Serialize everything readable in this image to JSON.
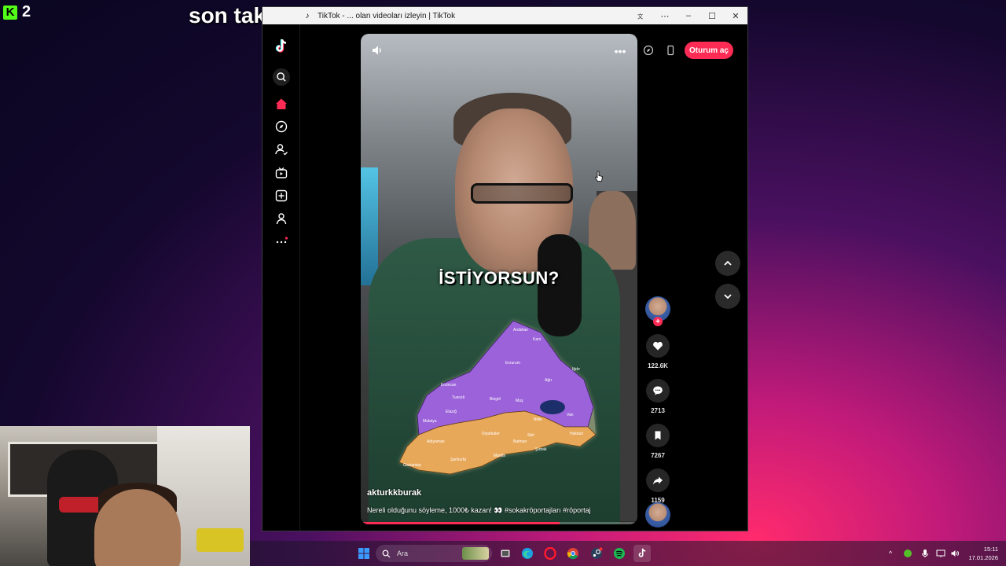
{
  "stream": {
    "viewer_count": "2",
    "overlay_caption": "son tak..."
  },
  "window": {
    "title": "TikTok - ... olan videoları izleyin | TikTok",
    "controls": [
      "translate",
      "more",
      "minimize",
      "maximize",
      "close"
    ]
  },
  "tiktok": {
    "login_label": "Oturum aç",
    "sidebar": [
      "logo",
      "search",
      "home",
      "explore",
      "following",
      "live",
      "upload",
      "profile",
      "more"
    ],
    "video": {
      "overlay_text": "İSTİYORSUN?",
      "author": "akturkkburak",
      "description": "Nereli olduğunu söyleme, 1000₺ kazan! 👀 #sokakröportajları #röportaj",
      "progress": 0.72,
      "map_labels": [
        "Kars",
        "Erzurum",
        "Ağrı",
        "Erzincan",
        "Tunceli",
        "Bingöl",
        "Muş",
        "Van",
        "Elazığ",
        "Malatya",
        "Diyarbakır",
        "Siirt",
        "Adıyaman",
        "Şanlıurfa",
        "Mardin",
        "Şırnak",
        "Hakkari",
        "Gaziantep",
        "Batman",
        "Iğdır",
        "Bitlis",
        "Ardahan"
      ]
    },
    "actions": {
      "likes": "122.6K",
      "comments": "2713",
      "saves": "7267",
      "shares": "1159"
    }
  },
  "taskbar": {
    "search_placeholder": "Ara",
    "time": "15:11",
    "date": "17.01.2026"
  },
  "colors": {
    "tiktok_red": "#fe2c55",
    "kick_green": "#53fc18"
  }
}
